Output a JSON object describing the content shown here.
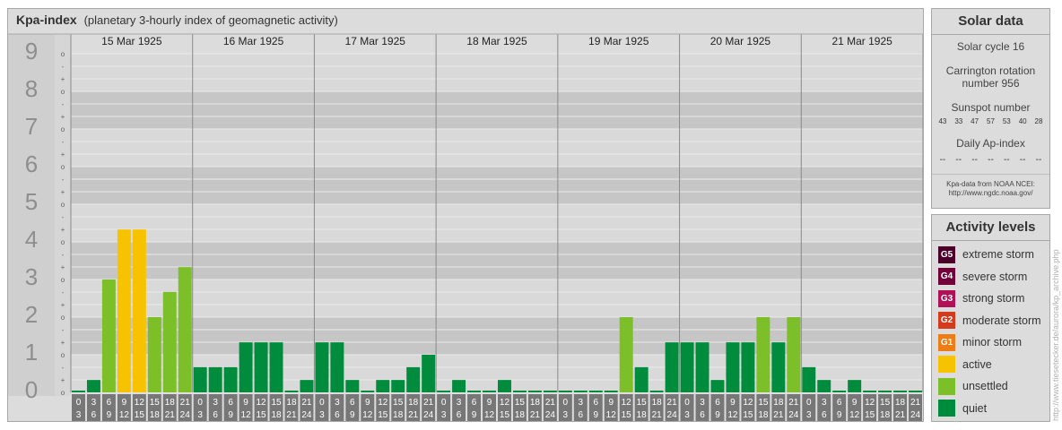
{
  "title": {
    "main": "Kpa-index",
    "sub": "(planetary 3-hourly index of geomagnetic activity)"
  },
  "chart_data": {
    "type": "bar",
    "title": "Kpa-index",
    "ylim": [
      0,
      9
    ],
    "y_major_ticks": [
      "0",
      "1",
      "2",
      "3",
      "4",
      "5",
      "6",
      "7",
      "8",
      "9"
    ],
    "y_minor_ticks": [
      "o",
      "+",
      "-"
    ],
    "days": [
      "15 Mar 1925",
      "16 Mar 1925",
      "17 Mar 1925",
      "18 Mar 1925",
      "19 Mar 1925",
      "20 Mar 1925",
      "21 Mar 1925"
    ],
    "interval_starts": [
      "0",
      "3",
      "6",
      "9",
      "12",
      "15",
      "18",
      "21"
    ],
    "interval_ends": [
      "3",
      "6",
      "9",
      "12",
      "15",
      "18",
      "21",
      "24"
    ],
    "values": [
      0,
      0.33,
      3,
      4.33,
      4.33,
      2,
      2.67,
      3.33,
      0.67,
      0.67,
      0.67,
      1.33,
      1.33,
      1.33,
      0,
      0.33,
      1.33,
      1.33,
      0.33,
      0,
      0.33,
      0.33,
      0.67,
      1,
      0,
      0.33,
      0,
      0,
      0.33,
      0,
      0,
      0,
      0,
      0,
      0,
      0,
      2,
      0.67,
      0,
      1.33,
      1.33,
      1.33,
      0.33,
      1.33,
      1.33,
      2,
      1.33,
      2,
      0.67,
      0.33,
      0,
      0.33,
      0,
      0,
      0,
      0
    ],
    "level_colors": {
      "quiet": "#008c3c",
      "unsettled": "#7dbf28",
      "active": "#f7c300"
    }
  },
  "solar": {
    "title": "Solar data",
    "solar_cycle": "Solar cycle 16",
    "carrington_line1": "Carrington rotation",
    "carrington_line2": "number 956",
    "sunspot_label": "Sunspot number",
    "sunspot_values": [
      "43",
      "33",
      "47",
      "57",
      "53",
      "40",
      "28"
    ],
    "ap_label": "Daily Ap-index",
    "ap_values": [
      "--",
      "--",
      "--",
      "--",
      "--",
      "--",
      "--"
    ],
    "source_line1": "Kpa-data from NOAA NCEI:",
    "source_line2": "http://www.ngdc.noaa.gov/"
  },
  "activity": {
    "title": "Activity levels",
    "levels": [
      {
        "badge": "G5",
        "label": "extreme storm",
        "color": "#4a0028"
      },
      {
        "badge": "G4",
        "label": "severe storm",
        "color": "#74003a"
      },
      {
        "badge": "G3",
        "label": "strong storm",
        "color": "#b01055"
      },
      {
        "badge": "G2",
        "label": "moderate storm",
        "color": "#d63a1c"
      },
      {
        "badge": "G1",
        "label": "minor storm",
        "color": "#ee7d16"
      },
      {
        "badge": "",
        "label": "active",
        "color": "#f7c300"
      },
      {
        "badge": "",
        "label": "unsettled",
        "color": "#7dbf28"
      },
      {
        "badge": "",
        "label": "quiet",
        "color": "#008c3c"
      }
    ]
  },
  "credit": "http://www.tiesetecker.de/aurora/kp_archive.php"
}
